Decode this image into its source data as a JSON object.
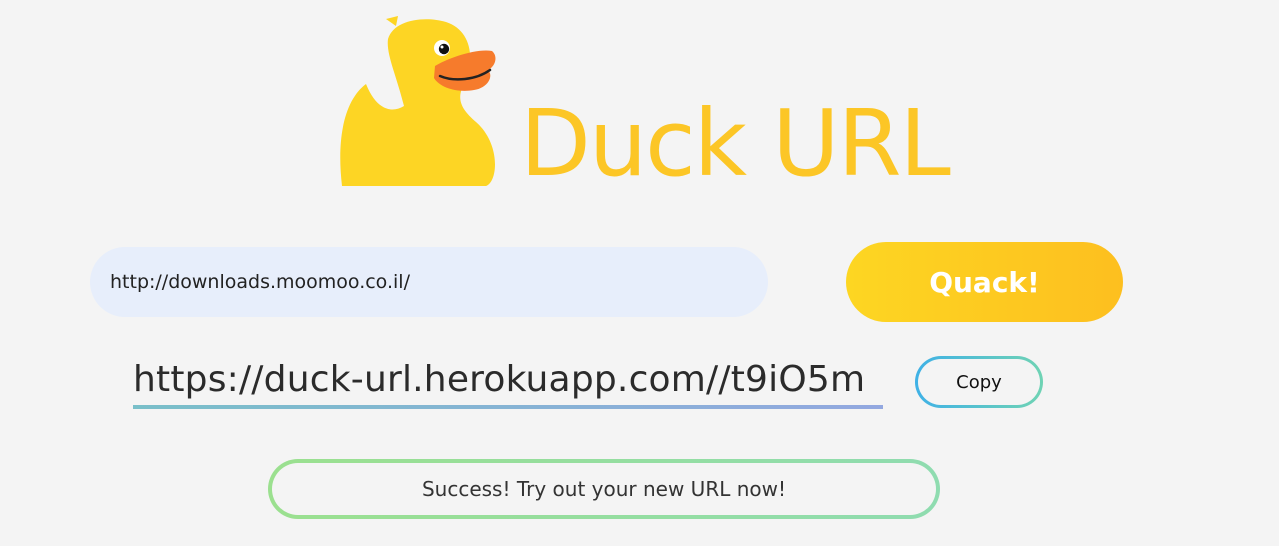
{
  "brand": {
    "name": "Duck URL",
    "logo_icon": "rubber-duck-icon",
    "colors": {
      "duck_body": "#fdd524",
      "duck_beak": "#f67b2c",
      "title_text": "#fcc626"
    }
  },
  "form": {
    "url_input_value": "http://downloads.moomoo.co.il/",
    "submit_label": "Quack!"
  },
  "result": {
    "short_url": "https://duck-url.herokuapp.com//t9iO5m",
    "copy_label": "Copy"
  },
  "status": {
    "message": "Success! Try out your new URL now!"
  },
  "colors": {
    "background": "#f4f4f4",
    "input_bg": "#e7eefb",
    "button_gradient_start": "#fdd622",
    "button_gradient_end": "#fdbf1f",
    "copy_border_start": "#3fb1e6",
    "copy_border_end": "#6fd3b4",
    "status_border": "#9be08f"
  }
}
